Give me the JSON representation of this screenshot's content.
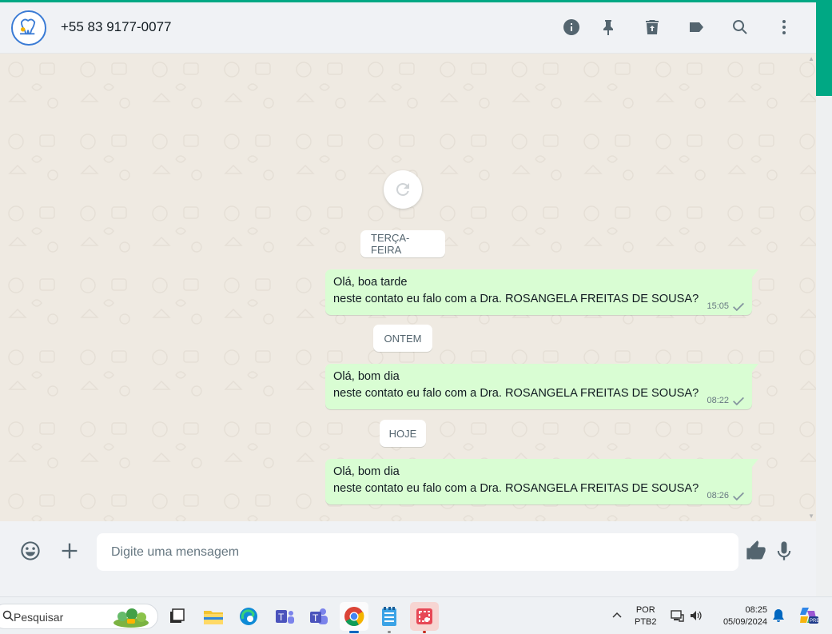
{
  "header": {
    "contact_name": "+55 83 9177-0077",
    "icons": [
      "info-icon",
      "pin-icon",
      "delete-icon",
      "label-icon",
      "search-icon",
      "more-icon"
    ]
  },
  "chat": {
    "reload_icon": "refresh-icon",
    "groups": [
      {
        "date": "TERÇA-FEIRA",
        "message": {
          "lines": [
            "Olá, boa tarde",
            "neste contato eu falo com a Dra. ROSANGELA FREITAS DE SOUSA?"
          ],
          "time": "15:05",
          "status": "sent"
        }
      },
      {
        "date": "ONTEM",
        "message": {
          "lines": [
            "Olá, bom dia",
            "neste contato eu falo com a Dra. ROSANGELA FREITAS DE SOUSA?"
          ],
          "time": "08:22",
          "status": "sent"
        }
      },
      {
        "date": "HOJE",
        "message": {
          "lines": [
            "Olá, bom dia",
            "neste contato eu falo com a Dra. ROSANGELA FREITAS DE SOUSA?"
          ],
          "time": "08:26",
          "status": "sent"
        }
      }
    ]
  },
  "composer": {
    "placeholder": "Digite uma mensagem",
    "icons": [
      "emoji-icon",
      "attach-plus-icon",
      "thumbs-up-icon",
      "microphone-icon"
    ]
  },
  "taskbar": {
    "search_label": "Pesquisar",
    "apps": [
      "task-view",
      "file-explorer",
      "edge",
      "teams-work",
      "teams",
      "chrome",
      "notepad",
      "snipping-tool"
    ],
    "language_line1": "POR",
    "language_line2": "PTB2",
    "time": "08:25",
    "date": "05/09/2024"
  },
  "colors": {
    "accent": "#00a884",
    "outgoing_bubble": "#d9fdd3",
    "chat_background": "#efeae2"
  }
}
